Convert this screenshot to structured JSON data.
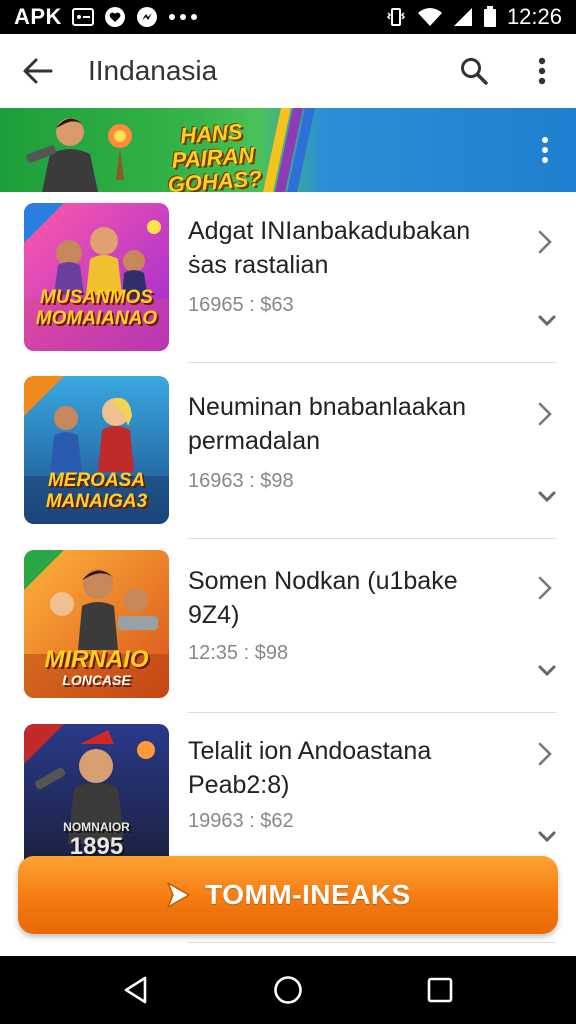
{
  "status_bar": {
    "carrier_label": "APK",
    "time": "12:26",
    "icons": [
      "screenshot-icon",
      "heart-icon",
      "messenger-icon",
      "more-dots-icon",
      "vibrate-icon",
      "wifi-icon",
      "signal-icon",
      "battery-icon"
    ]
  },
  "app_bar": {
    "title": "IIndanasia",
    "back_icon": "arrow-left-icon",
    "search_icon": "search-icon",
    "menu_icon": "more-vert-icon"
  },
  "banner": {
    "text_line1": "HANS PAIRAN",
    "text_line2": "GOHAS?"
  },
  "items": [
    {
      "title": "Adgat INIanbakadubakan ṡas rastalian",
      "meta": "16965 : $63",
      "thumb_text_top": "MUSANMOS",
      "thumb_text_bottom": "MOMAIANAO"
    },
    {
      "title": "Neuminan bnabanlaakan permadalan",
      "meta": "16963 : $98",
      "thumb_text_top": "MEROASA",
      "thumb_text_bottom": "MANAIGA3"
    },
    {
      "title": "Somen Nodkan (u1bake 9Z4)",
      "meta": "12:35 : $98",
      "thumb_text_top": "MIRNAIO",
      "thumb_text_bottom": "LONCASE"
    },
    {
      "title": "Telalit ion Andoastana Peab2:8)",
      "meta": "19963 : $62",
      "thumb_text_top": "NOMNAIOR",
      "thumb_text_bottom": "1895"
    }
  ],
  "cta": {
    "label": "TOMM-INEAKS",
    "icon": "play-arrow-icon"
  },
  "nav_bar": {
    "icons": [
      "nav-back-icon",
      "nav-home-icon",
      "nav-recents-icon"
    ]
  },
  "colors": {
    "accent": "#f47b12",
    "banner_green": "#2aa845",
    "banner_blue": "#1e7fd0",
    "status_bar": "#000000"
  }
}
